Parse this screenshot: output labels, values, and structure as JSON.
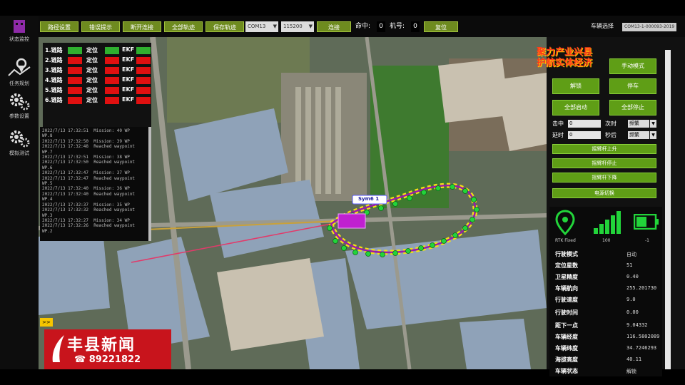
{
  "rail": {
    "items": [
      {
        "label": "状态监控",
        "icon": "robot-icon"
      },
      {
        "label": "任务规划",
        "icon": "map-pin-icon"
      },
      {
        "label": "参数设置",
        "icon": "gear-icon"
      },
      {
        "label": "模拟测试",
        "icon": "gear-icon"
      }
    ]
  },
  "toolbar": {
    "buttons": [
      "路径设置",
      "错误提示",
      "断开连接",
      "全部轨迹",
      "保存轨迹"
    ],
    "select1": "COM13",
    "select2": "115200",
    "connect_label": "连接",
    "ming_label": "命中:",
    "ming_value": "0",
    "jihao_label": "机号:",
    "jihao_value": "0",
    "action_label": "复位",
    "vehicle_label": "车辆选择",
    "vehicle_value": "COM13-1-000093-2019"
  },
  "slogan": [
    "聚力产业兴县",
    "护航实体经济"
  ],
  "status_rows": [
    {
      "label": "1.链路",
      "pos": "定位",
      "ekf": "EKF",
      "color": "#2fb02f"
    },
    {
      "label": "2.链路",
      "pos": "定位",
      "ekf": "EKF",
      "color": "#e01010"
    },
    {
      "label": "3.链路",
      "pos": "定位",
      "ekf": "EKF",
      "color": "#e01010"
    },
    {
      "label": "4.链路",
      "pos": "定位",
      "ekf": "EKF",
      "color": "#e01010"
    },
    {
      "label": "5.链路",
      "pos": "定位",
      "ekf": "EKF",
      "color": "#e01010"
    },
    {
      "label": "6.链路",
      "pos": "定位",
      "ekf": "EKF",
      "color": "#e01010"
    }
  ],
  "log_lines": [
    "2022/7/13 17:32:51  Mission: 40 WP",
    "WP.8",
    "2022/7/13 17:32:50  Mission: 39 WP",
    "2022/7/13 17:32:48  Reached waypoint",
    "WP.7",
    "2022/7/13 17:32:51  Mission: 38 WP",
    "2022/7/13 17:32:50  Reached waypoint",
    "WP.6",
    "2022/7/13 17:32:47  Mission: 37 WP",
    "2022/7/13 17:32:47  Reached waypoint",
    "WP.5",
    "2022/7/13 17:32:40  Mission: 36 WP",
    "2022/7/13 17:32:40  Reached waypoint",
    "WP.4",
    "2022/7/13 17:32:37  Mission: 35 WP",
    "2022/7/13 17:32:32  Reached waypoint",
    "WP.3",
    "2022/7/13 17:32:27  Mission: 34 WP",
    "2022/7/13 17:32:26  Reached waypoint",
    "WP.2"
  ],
  "vehicle_tag": "Sym6 1",
  "panel": {
    "mode_button": "手动模式",
    "buttons": [
      [
        "解锁",
        "停车"
      ],
      [
        "全部启动",
        "全部停止"
      ]
    ],
    "row1": {
      "label_a": "击中",
      "value_a": "0",
      "label_b": "次时",
      "select": "频繁"
    },
    "row2": {
      "label_a": "延时",
      "value_a": "0",
      "label_b": "秒后",
      "select": "频繁"
    },
    "wide_buttons": [
      "摇臂杆上升",
      "摇臂杆停止",
      "摇臂杆下降",
      "电源切换"
    ]
  },
  "signal": {
    "rtk": "RTK Fixed",
    "strength": "100",
    "battery": "-1"
  },
  "info_rows": [
    {
      "k": "行驶模式",
      "v": "自动"
    },
    {
      "k": "定位星数",
      "v": "51"
    },
    {
      "k": "卫星精度",
      "v": "0.40"
    },
    {
      "k": "车辆航向",
      "v": "255.201730"
    },
    {
      "k": "行驶速度",
      "v": "9.0"
    },
    {
      "k": "行驶时间",
      "v": "0.00"
    },
    {
      "k": "距下一点",
      "v": "9.04332"
    },
    {
      "k": "车辆经度",
      "v": "116.5802089"
    },
    {
      "k": "车辆纬度",
      "v": "34.7246293"
    },
    {
      "k": "海拔高度",
      "v": "40.11"
    },
    {
      "k": "车辆状态",
      "v": "解锁"
    }
  ],
  "news": {
    "title": "丰县新闻",
    "phone": "☎ 89221822",
    "corner": ">>"
  },
  "colors": {
    "button_green": "#6e8b1f",
    "panel_green": "#5f9e16",
    "led_green": "#2fb02f",
    "led_red": "#e01010",
    "slogan_red": "#ff3a1a",
    "news_red": "#c8141c",
    "path_magenta": "#9a1aa8",
    "waypoint_green": "#22d43a"
  }
}
